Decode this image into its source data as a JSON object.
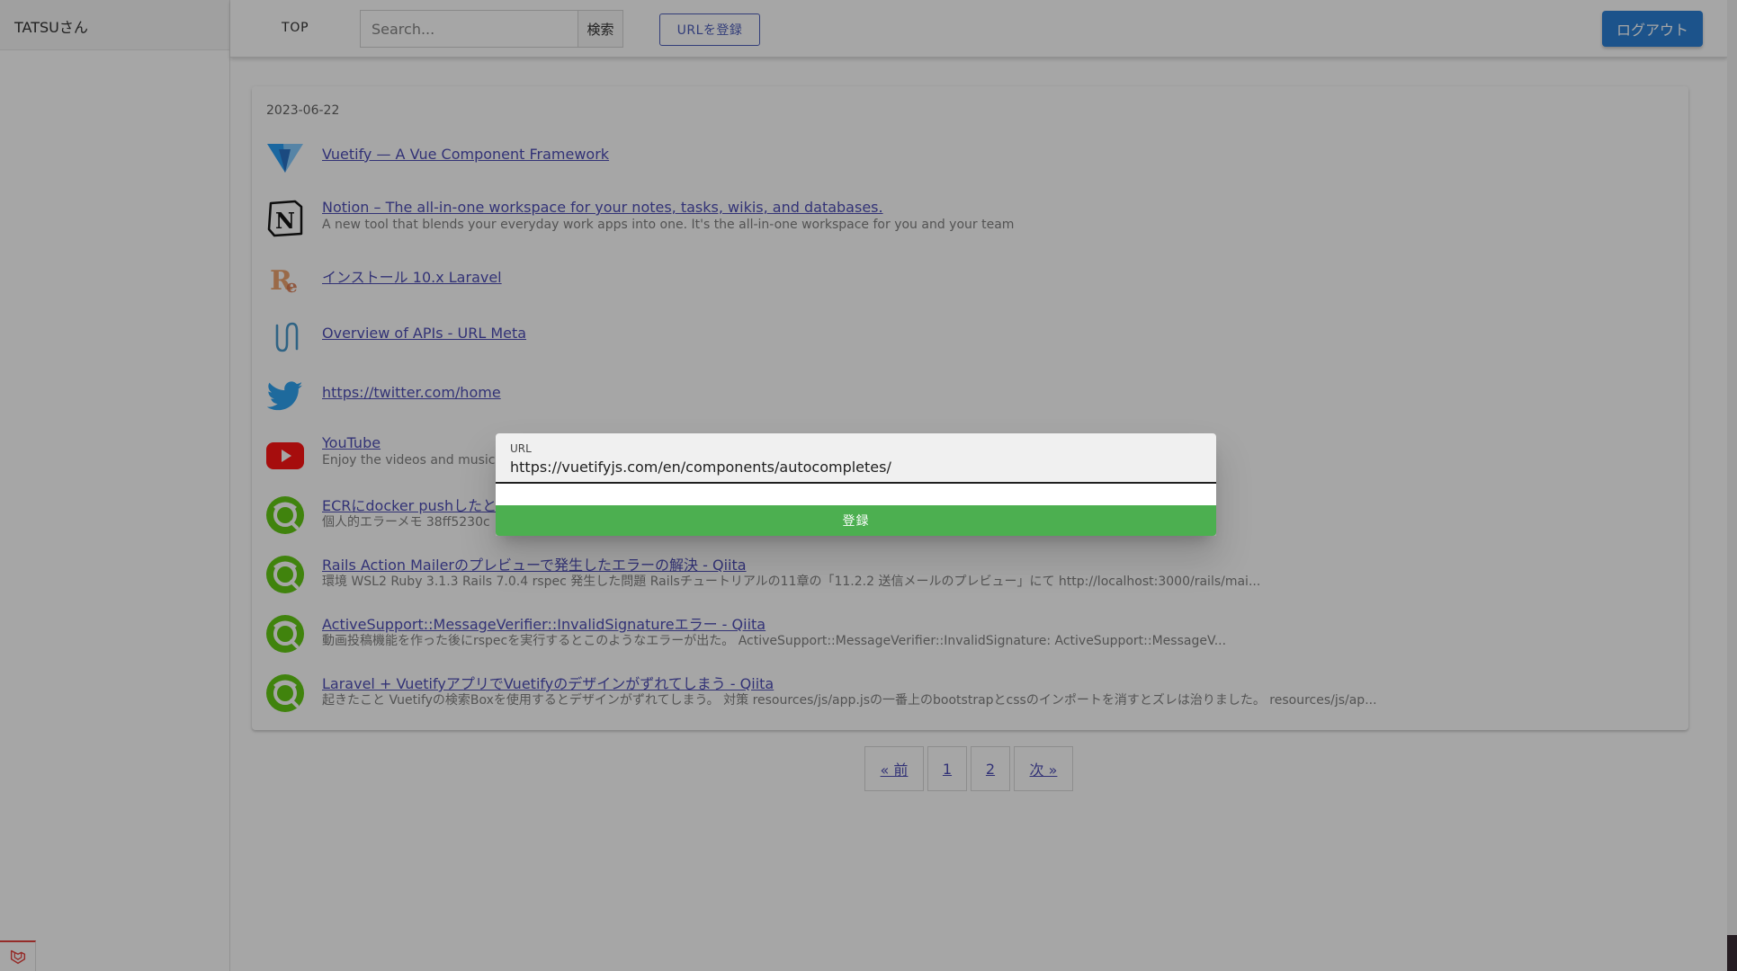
{
  "sidebar": {
    "user_name": "TATSUさん"
  },
  "header": {
    "top_link": "TOP",
    "search": {
      "placeholder": "Search...",
      "value": ""
    },
    "search_button": "検索",
    "register_url_button": "URLを登録",
    "logout_button": "ログアウト"
  },
  "main": {
    "date": "2023-06-22",
    "bookmarks": [
      {
        "icon": "vuetify-icon",
        "title": "Vuetify — A Vue Component Framework",
        "description": ""
      },
      {
        "icon": "notion-icon",
        "title": "Notion – The all-in-one workspace for your notes, tasks, wikis, and databases.",
        "description": "A new tool that blends your everyday work apps into one. It's the all-in-one workspace for you and your team"
      },
      {
        "icon": "readouble-icon",
        "title": "インストール 10.x Laravel",
        "description": ""
      },
      {
        "icon": "urlmeta-icon",
        "title": "Overview of APIs - URL Meta",
        "description": ""
      },
      {
        "icon": "twitter-icon",
        "title": "https://twitter.com/home",
        "description": ""
      },
      {
        "icon": "youtube-icon",
        "title": "YouTube",
        "description": "Enjoy the videos and music"
      },
      {
        "icon": "qiita-icon",
        "title": "ECRにdocker pushしたと",
        "description": "個人的エラーメモ 38ff5230c"
      },
      {
        "icon": "qiita-icon",
        "title": "Rails Action Mailerのプレビューで発生したエラーの解決 - Qiita",
        "description": "環境 WSL2 Ruby 3.1.3 Rails 7.0.4 rspec 発生した問題 Railsチュートリアルの11章の「11.2.2 送信メールのプレビュー」にて http://localhost:3000/rails/mai..."
      },
      {
        "icon": "qiita-icon",
        "title": "ActiveSupport::MessageVerifier::InvalidSignatureエラー - Qiita",
        "description": "動画投稿機能を作った後にrspecを実行するとこのようなエラーが出た。 ActiveSupport::MessageVerifier::InvalidSignature: ActiveSupport::MessageV..."
      },
      {
        "icon": "qiita-icon",
        "title": "Laravel + VuetifyアプリでVuetifyのデザインがずれてしまう - Qiita",
        "description": "起きたこと Vuetifyの検索Boxを使用するとデザインがずれてしまう。 対策 resources/js/app.jsの一番上のbootstrapとcssのインポートを消すとズレは治りました。 resources/js/ap..."
      }
    ]
  },
  "pagination": {
    "prev": "« 前",
    "pages": [
      "1",
      "2"
    ],
    "next": "次 »"
  },
  "dialog": {
    "url_label": "URL",
    "url_value": "https://vuetifyjs.com/en/components/autocompletes/",
    "submit_button": "登録"
  },
  "colors": {
    "primary": "#1976d2",
    "indigo": "#3f51b5",
    "success": "#4caf50",
    "link": "#3f3fb0"
  }
}
